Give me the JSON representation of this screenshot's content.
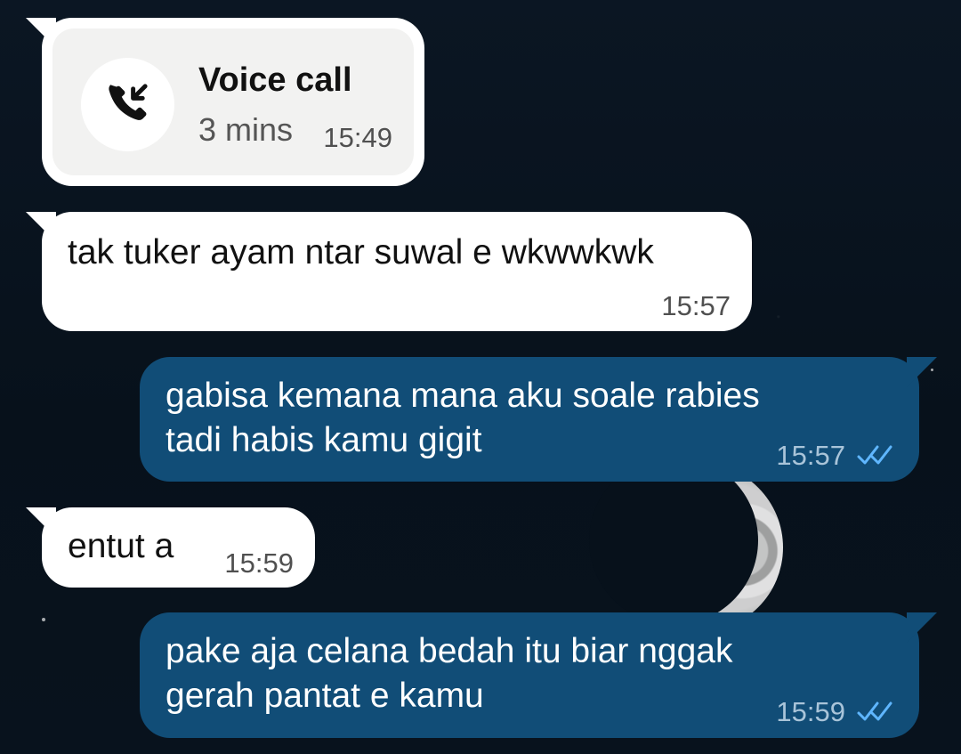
{
  "chat": {
    "voice_call": {
      "title": "Voice call",
      "duration": "3 mins",
      "time": "15:49",
      "icon": "incoming-call-icon"
    },
    "messages": [
      {
        "direction": "incoming",
        "lines": [
          "tak tuker ayam ntar suwal e wkwwkwk"
        ],
        "time": "15:57"
      },
      {
        "direction": "outgoing",
        "lines": [
          "gabisa kemana mana aku soale rabies",
          "tadi habis kamu gigit"
        ],
        "time": "15:57",
        "status_icon": "double-check-icon"
      },
      {
        "direction": "incoming",
        "lines": [
          "entut a"
        ],
        "time": "15:59"
      },
      {
        "direction": "outgoing",
        "lines": [
          "pake aja celana bedah itu biar nggak",
          "gerah pantat e kamu"
        ],
        "time": "15:59",
        "status_icon": "double-check-icon"
      }
    ]
  },
  "colors": {
    "background": "#081421",
    "incoming_bubble": "#ffffff",
    "outgoing_bubble": "#114d77",
    "read_ticks": "#5fb6ff"
  }
}
